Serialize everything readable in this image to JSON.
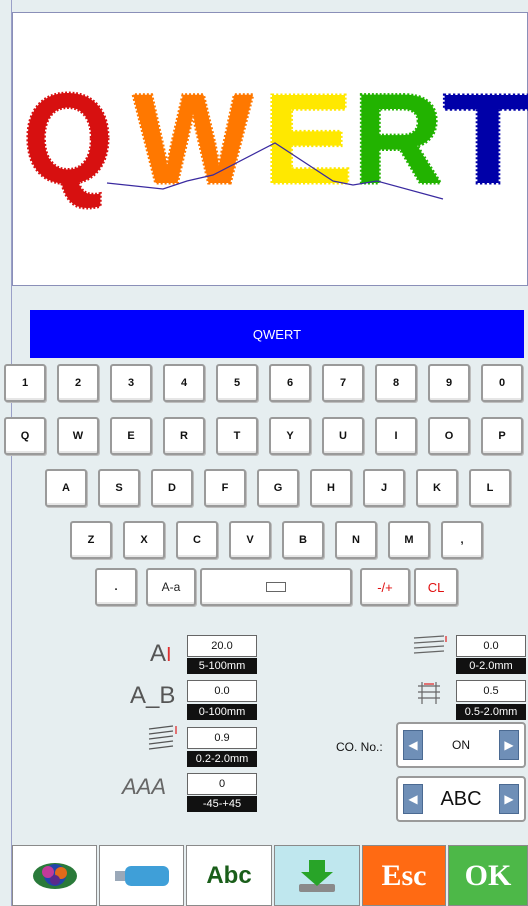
{
  "name_display": "QWERT",
  "preview": {
    "letters": [
      "Q",
      "W",
      "E",
      "R",
      "T"
    ],
    "colors": [
      "#d71010",
      "#ff7800",
      "#ffe800",
      "#22b300",
      "#0000a8"
    ]
  },
  "keyboard": {
    "row1": [
      "1",
      "2",
      "3",
      "4",
      "5",
      "6",
      "7",
      "8",
      "9",
      "0"
    ],
    "row2": [
      "Q",
      "W",
      "E",
      "R",
      "T",
      "Y",
      "U",
      "I",
      "O",
      "P"
    ],
    "row3": [
      "A",
      "S",
      "D",
      "F",
      "G",
      "H",
      "J",
      "K",
      "L"
    ],
    "row4": [
      "Z",
      "X",
      "C",
      "V",
      "B",
      "N",
      "M",
      ","
    ],
    "row5": {
      "dot": ".",
      "case": "A-a",
      "sign": "-/+",
      "clear": "CL"
    }
  },
  "params": {
    "height": {
      "value": "20.0",
      "range": "5-100mm"
    },
    "spacing": {
      "label": "A_B",
      "value": "0.0",
      "range": "0-100mm"
    },
    "density": {
      "value": "0.9",
      "range": "0.2-2.0mm"
    },
    "slant": {
      "label": "AAA",
      "value": "0",
      "range": "-45-+45"
    },
    "right_top": {
      "value": "0.0",
      "range": "0-2.0mm"
    },
    "right_mid": {
      "value": "0.5",
      "range": "0.5-2.0mm"
    }
  },
  "co": {
    "label": "CO. No.:",
    "value": "ON"
  },
  "font_select": {
    "value": "ABC"
  },
  "toolbar": {
    "abc": "Abc",
    "esc": "Esc",
    "ok": "OK"
  },
  "colors": {
    "name_bar": "#0000ff",
    "esc": "#ff6a13",
    "ok": "#4db848"
  }
}
